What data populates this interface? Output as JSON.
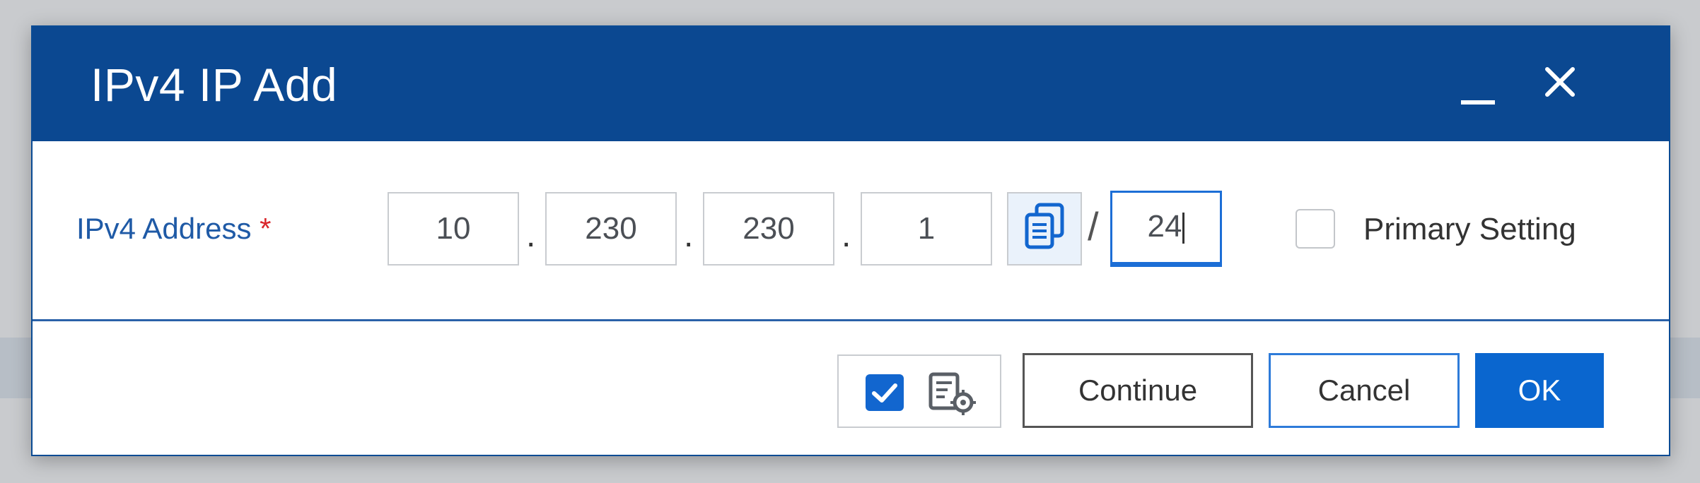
{
  "dialog": {
    "title": "IPv4 IP Add",
    "minimize_icon": "minimize-icon",
    "close_icon": "close-icon"
  },
  "form": {
    "label": "IPv4 Address",
    "required_mark": "*",
    "octets": [
      "10",
      "230",
      "230",
      "1"
    ],
    "separator": ".",
    "copy_icon": "copy-icon",
    "prefix_separator": "/",
    "prefix": "24",
    "primary_setting_label": "Primary Setting",
    "primary_setting_checked": false
  },
  "footer": {
    "option_checked": true,
    "settings_icon": "list-settings-icon",
    "continue_label": "Continue",
    "cancel_label": "Cancel",
    "ok_label": "OK"
  },
  "colors": {
    "titlebar": "#0b4891",
    "accent": "#0a66cf",
    "label": "#1f5aa6",
    "required": "#d9262b"
  }
}
